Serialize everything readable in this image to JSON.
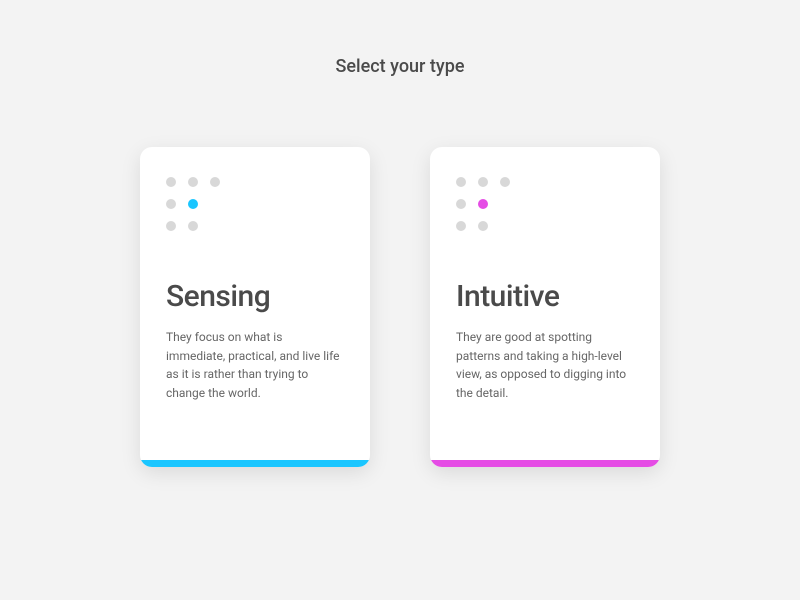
{
  "title": "Select your type",
  "cards": [
    {
      "id": "sensing",
      "title": "Sensing",
      "description": "They focus on what is immediate, practical, and live life as it is rather than trying to change the world.",
      "accent_color": "#1ac6ff"
    },
    {
      "id": "intuitive",
      "title": "Intuitive",
      "description": "They are good at spotting patterns and taking a high-level view, as opposed to digging into the detail.",
      "accent_color": "#e54ce5"
    }
  ]
}
